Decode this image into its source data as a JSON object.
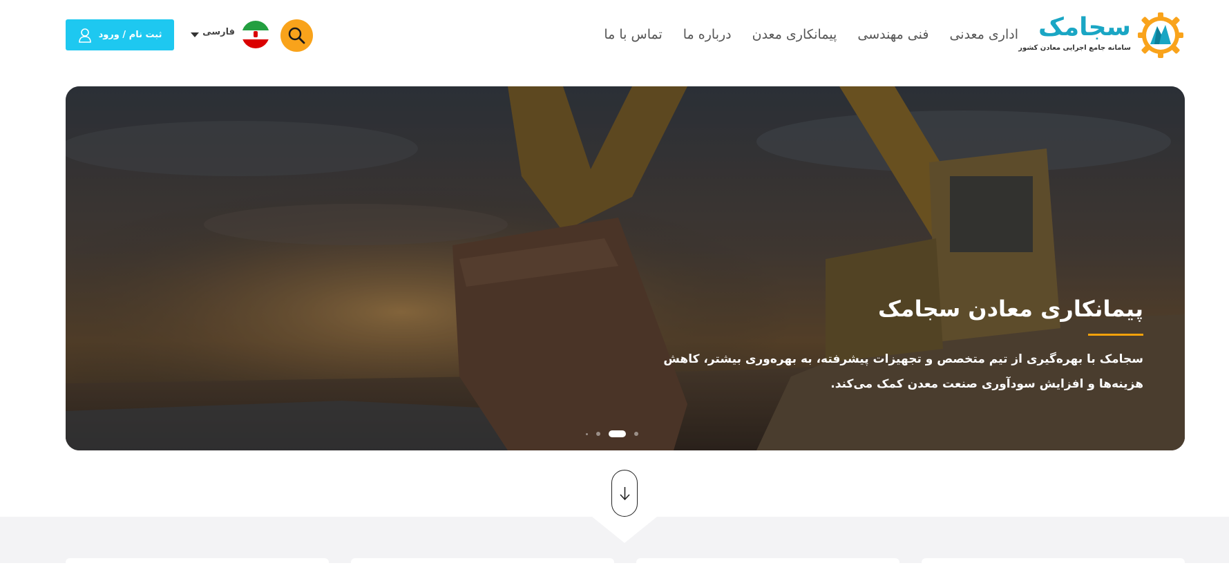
{
  "brand": {
    "name": "سجامک",
    "tagline": "سامانه جامع اجرایی معادن کشور"
  },
  "nav": {
    "items": [
      {
        "label": "اداری معدنی"
      },
      {
        "label": "فنی مهندسی"
      },
      {
        "label": "پیمانکاری معدن"
      },
      {
        "label": "درباره ما"
      },
      {
        "label": "تماس با ما"
      }
    ]
  },
  "search": {
    "icon": "search-icon"
  },
  "language": {
    "selected": "فارسی",
    "flag": "iran-flag-icon"
  },
  "auth": {
    "login_label": "ثبت نام / ورود",
    "icon": "user-icon"
  },
  "hero": {
    "title": "پیمانکاری معادن سجامک",
    "description": "سجامک با بهره‌گیری از تیم متخصص و تجهیزات پیشرفته، به بهره‌وری بیشتر، کاهش هزینه‌ها و افزایش سودآوری صنعت معدن کمک می‌کند.",
    "slide_count": 4,
    "active_slide": 3
  },
  "colors": {
    "brand": "#1aa6c4",
    "accent": "#f9a31b",
    "login": "#1ec8f0",
    "underline": "#f2a20b"
  }
}
